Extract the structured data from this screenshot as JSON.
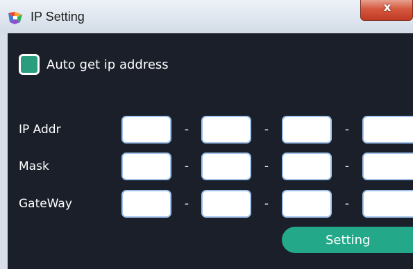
{
  "window": {
    "title": "IP Setting",
    "close_label": "x"
  },
  "auto_ip": {
    "label": "Auto get ip address",
    "checked": true,
    "color": "#2a9d7f"
  },
  "fields": {
    "ip": {
      "label": "IP Addr",
      "octets": [
        "",
        "",
        "",
        ""
      ]
    },
    "mask": {
      "label": "Mask",
      "octets": [
        "",
        "",
        "",
        ""
      ]
    },
    "gateway": {
      "label": "GateWay",
      "octets": [
        "",
        "",
        "",
        ""
      ]
    }
  },
  "separator": "-",
  "setting_button": {
    "label": "Setting",
    "color": "#23a98a"
  },
  "icons": {
    "app": "app-logo-icon",
    "close": "close-icon"
  }
}
